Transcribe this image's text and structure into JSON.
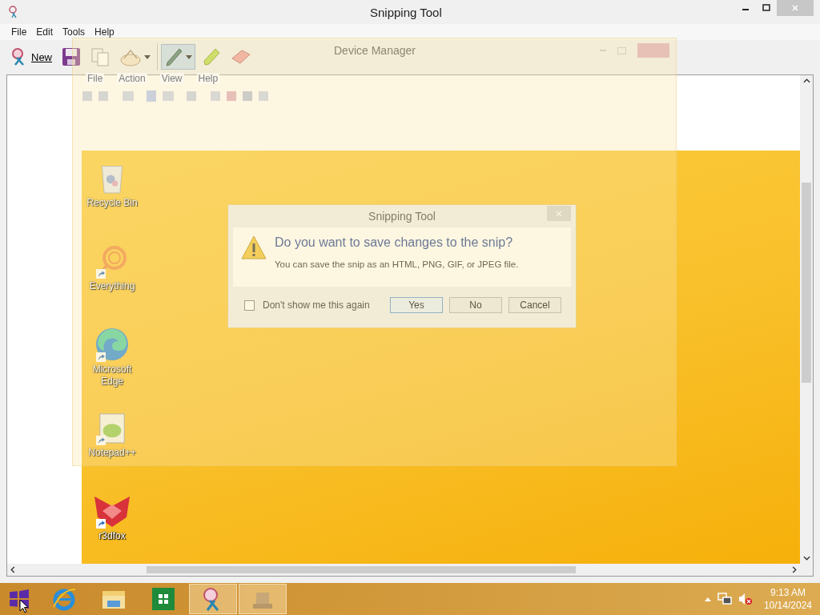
{
  "window": {
    "title": "Snipping Tool"
  },
  "menu": [
    "File",
    "Edit",
    "Tools",
    "Help"
  ],
  "toolbar": [
    {
      "kind": "new",
      "label": "New",
      "selected": false,
      "dropdown": false
    },
    {
      "kind": "save",
      "selected": false,
      "dropdown": false
    },
    {
      "kind": "copy",
      "selected": false,
      "dropdown": false
    },
    {
      "kind": "send",
      "selected": false,
      "dropdown": true
    },
    {
      "kind": "pen",
      "selected": true,
      "dropdown": true
    },
    {
      "kind": "highlighter",
      "selected": false,
      "dropdown": false
    },
    {
      "kind": "eraser",
      "selected": false,
      "dropdown": false
    }
  ],
  "ghost_window": {
    "title": "Device Manager",
    "menu": [
      "File",
      "Action",
      "View",
      "Help"
    ]
  },
  "desktop": {
    "icons": [
      {
        "kind": "recycle-bin",
        "label": "Recycle Bin",
        "shortcut": false
      },
      {
        "kind": "everything",
        "label": "Everything",
        "shortcut": true
      },
      {
        "kind": "edge",
        "label": "Microsoft Edge",
        "shortcut": true
      },
      {
        "kind": "notepad",
        "label": "Notepad++",
        "shortcut": true
      },
      {
        "kind": "fox",
        "label": "r3dfox",
        "shortcut": true
      }
    ]
  },
  "dialog": {
    "title": "Snipping Tool",
    "question": "Do you want to save changes to the snip?",
    "detail": "You can save the snip as an HTML, PNG, GIF, or JPEG file.",
    "checkbox": {
      "label": "Don't show me this again",
      "checked": false
    },
    "buttons": [
      {
        "label": "Yes",
        "selected": true
      },
      {
        "label": "No",
        "selected": false
      },
      {
        "label": "Cancel",
        "selected": false
      }
    ]
  },
  "taskbar": {
    "apps": [
      {
        "kind": "ie",
        "selected": false
      },
      {
        "kind": "explorer",
        "selected": false
      },
      {
        "kind": "store",
        "selected": false
      },
      {
        "kind": "snipping",
        "selected": true
      },
      {
        "kind": "device-manager",
        "selected": true
      }
    ],
    "time": "9:13 AM",
    "date": "10/14/2024"
  }
}
